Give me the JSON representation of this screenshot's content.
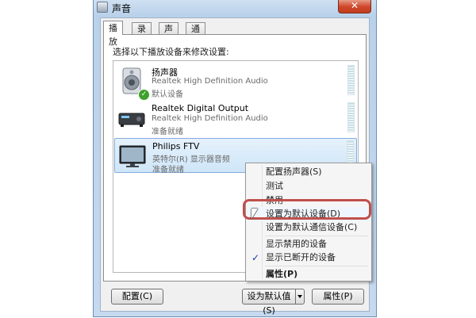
{
  "window": {
    "title": "声音",
    "close_label": "✕"
  },
  "tabs": [
    {
      "label": "播放",
      "active": true
    },
    {
      "label": "录制"
    },
    {
      "label": "声音"
    },
    {
      "label": "通信"
    }
  ],
  "instruction": "选择以下播放设备来修改设置:",
  "devices": [
    {
      "name": "扬声器",
      "description": "Realtek High Definition Audio",
      "status": "默认设备",
      "icon": "speaker-icon",
      "default": true
    },
    {
      "name": "Realtek Digital Output",
      "description": "Realtek High Definition Audio",
      "status": "准备就绪",
      "icon": "digital-output-icon"
    },
    {
      "name": "Philips FTV",
      "description": "英特尔(R) 显示器音频",
      "status": "准备就绪",
      "icon": "monitor-icon",
      "selected": true
    }
  ],
  "buttons": {
    "configure": "配置(C)",
    "set_default": "设为默认值(S)",
    "properties": "属性(P)"
  },
  "context_menu": {
    "items": [
      {
        "label": "配置扬声器(S)"
      },
      {
        "label": "测试"
      },
      {
        "label": "禁用"
      },
      {
        "label": "设置为默认设备(D)",
        "highlighted": true
      },
      {
        "label": "设置为默认通信设备(C)"
      },
      {
        "label": "显示禁用的设备"
      },
      {
        "label": "显示已断开的设备",
        "checked": true
      },
      {
        "label": "属性(P)",
        "bold": true
      }
    ]
  },
  "colors": {
    "accent_ring": "#c0504d",
    "selection": "#cfe6f8",
    "default_badge": "#3ea12c"
  }
}
